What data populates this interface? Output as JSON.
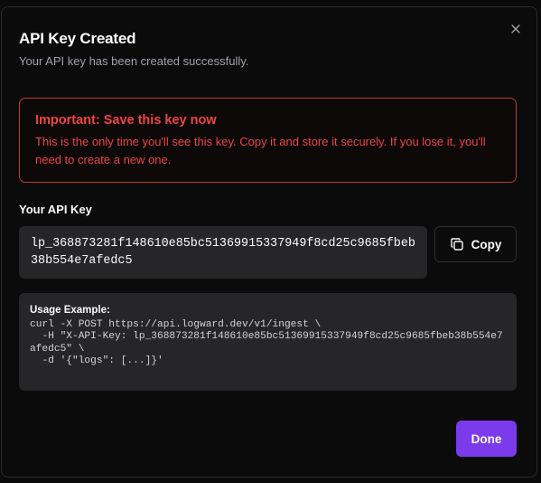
{
  "dialog": {
    "title": "API Key Created",
    "subtitle": "Your API key has been created successfully.",
    "close_icon": "x-icon"
  },
  "alert": {
    "title": "Important: Save this key now",
    "body": "This is the only time you'll see this key. Copy it and store it securely. If you lose it, you'll need to create a new one."
  },
  "key": {
    "label": "Your API Key",
    "value": "lp_368873281f148610e85bc51369915337949f8cd25c9685fbeb38b554e7afedc5",
    "copy_label": "Copy",
    "copy_icon": "copy-icon"
  },
  "usage": {
    "title": "Usage Example:",
    "code": "curl -X POST https://api.logward.dev/v1/ingest \\\n  -H \"X-API-Key: lp_368873281f148610e85bc51369915337949f8cd25c9685fbeb38b554e7afedc5\" \\\n  -d '{\"logs\": [...]}'"
  },
  "actions": {
    "done_label": "Done"
  },
  "colors": {
    "accent": "#7c3aed",
    "danger": "#ef4444",
    "background": "#0b0b0c",
    "surface": "#262628"
  }
}
